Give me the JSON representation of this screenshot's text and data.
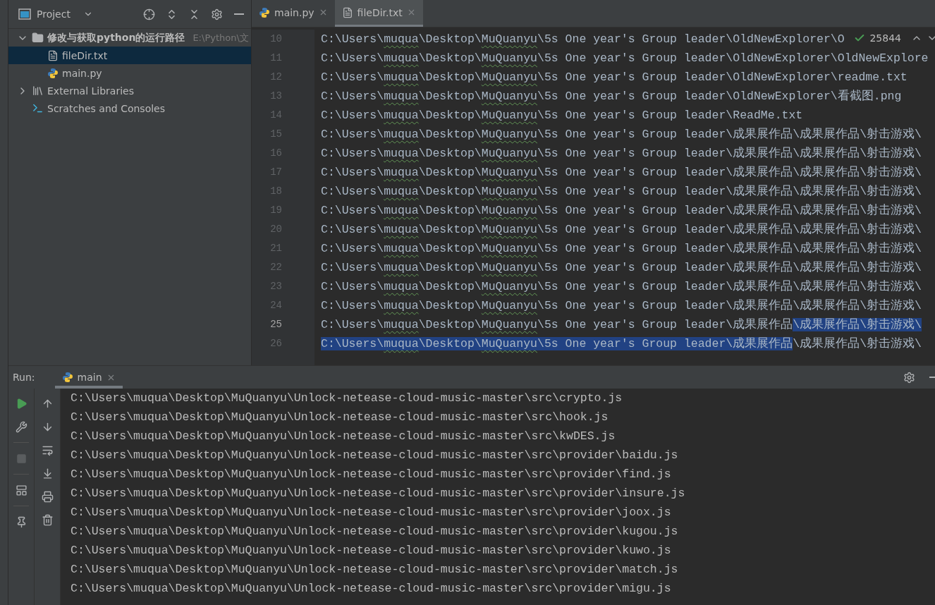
{
  "project_panel": {
    "title": "Project",
    "tree": [
      {
        "label": "修改与获取python的运行路径",
        "path": "E:\\Python\\文",
        "kind": "folder",
        "expanded": true,
        "selected": false,
        "children": [
          {
            "label": "fileDir.txt",
            "kind": "text-file",
            "selected": true
          },
          {
            "label": "main.py",
            "kind": "python-file",
            "selected": false
          }
        ]
      },
      {
        "label": "External Libraries",
        "kind": "library",
        "expanded": false,
        "selected": false
      },
      {
        "label": "Scratches and Consoles",
        "kind": "scratches",
        "selected": false
      }
    ]
  },
  "editor": {
    "tabs": [
      {
        "label": "main.py",
        "kind": "python-file",
        "selected": false
      },
      {
        "label": "fileDir.txt",
        "kind": "text-file",
        "selected": true
      }
    ],
    "inspection": {
      "count": "25844"
    },
    "lines": [
      {
        "number": "10",
        "current": false,
        "segments": [
          {
            "text": "C:\\Users\\",
            "typo": false,
            "selected": false
          },
          {
            "text": "muqua",
            "typo": true,
            "selected": false
          },
          {
            "text": "\\Desktop\\",
            "typo": false,
            "selected": false
          },
          {
            "text": "MuQuanyu",
            "typo": true,
            "selected": false
          },
          {
            "text": "\\5s One year's Group leader\\OldNewExplorer\\O",
            "typo": false,
            "selected": false
          }
        ]
      },
      {
        "number": "11",
        "current": false,
        "segments": [
          {
            "text": "C:\\Users\\",
            "typo": false,
            "selected": false
          },
          {
            "text": "muqua",
            "typo": true,
            "selected": false
          },
          {
            "text": "\\Desktop\\",
            "typo": false,
            "selected": false
          },
          {
            "text": "MuQuanyu",
            "typo": true,
            "selected": false
          },
          {
            "text": "\\5s One year's Group leader\\OldNewExplorer\\OldNewExplore",
            "typo": false,
            "selected": false
          }
        ]
      },
      {
        "number": "12",
        "current": false,
        "segments": [
          {
            "text": "C:\\Users\\",
            "typo": false,
            "selected": false
          },
          {
            "text": "muqua",
            "typo": true,
            "selected": false
          },
          {
            "text": "\\Desktop\\",
            "typo": false,
            "selected": false
          },
          {
            "text": "MuQuanyu",
            "typo": true,
            "selected": false
          },
          {
            "text": "\\5s One year's Group leader\\OldNewExplorer\\readme.txt",
            "typo": false,
            "selected": false
          }
        ]
      },
      {
        "number": "13",
        "current": false,
        "segments": [
          {
            "text": "C:\\Users\\",
            "typo": false,
            "selected": false
          },
          {
            "text": "muqua",
            "typo": true,
            "selected": false
          },
          {
            "text": "\\Desktop\\",
            "typo": false,
            "selected": false
          },
          {
            "text": "MuQuanyu",
            "typo": true,
            "selected": false
          },
          {
            "text": "\\5s One year's Group leader\\OldNewExplorer\\看截图.png",
            "typo": false,
            "selected": false
          }
        ]
      },
      {
        "number": "14",
        "current": false,
        "segments": [
          {
            "text": "C:\\Users\\",
            "typo": false,
            "selected": false
          },
          {
            "text": "muqua",
            "typo": true,
            "selected": false
          },
          {
            "text": "\\Desktop\\",
            "typo": false,
            "selected": false
          },
          {
            "text": "MuQuanyu",
            "typo": true,
            "selected": false
          },
          {
            "text": "\\5s One year's Group leader\\ReadMe.txt",
            "typo": false,
            "selected": false
          }
        ]
      },
      {
        "number": "15",
        "current": false,
        "segments": [
          {
            "text": "C:\\Users\\",
            "typo": false,
            "selected": false
          },
          {
            "text": "muqua",
            "typo": true,
            "selected": false
          },
          {
            "text": "\\Desktop\\",
            "typo": false,
            "selected": false
          },
          {
            "text": "MuQuanyu",
            "typo": true,
            "selected": false
          },
          {
            "text": "\\5s One year's Group leader\\成果展作品\\成果展作品\\射击游戏\\",
            "typo": false,
            "selected": false
          }
        ]
      },
      {
        "number": "16",
        "current": false,
        "segments": [
          {
            "text": "C:\\Users\\",
            "typo": false,
            "selected": false
          },
          {
            "text": "muqua",
            "typo": true,
            "selected": false
          },
          {
            "text": "\\Desktop\\",
            "typo": false,
            "selected": false
          },
          {
            "text": "MuQuanyu",
            "typo": true,
            "selected": false
          },
          {
            "text": "\\5s One year's Group leader\\成果展作品\\成果展作品\\射击游戏\\",
            "typo": false,
            "selected": false
          }
        ]
      },
      {
        "number": "17",
        "current": false,
        "segments": [
          {
            "text": "C:\\Users\\",
            "typo": false,
            "selected": false
          },
          {
            "text": "muqua",
            "typo": true,
            "selected": false
          },
          {
            "text": "\\Desktop\\",
            "typo": false,
            "selected": false
          },
          {
            "text": "MuQuanyu",
            "typo": true,
            "selected": false
          },
          {
            "text": "\\5s One year's Group leader\\成果展作品\\成果展作品\\射击游戏\\",
            "typo": false,
            "selected": false
          }
        ]
      },
      {
        "number": "18",
        "current": false,
        "segments": [
          {
            "text": "C:\\Users\\",
            "typo": false,
            "selected": false
          },
          {
            "text": "muqua",
            "typo": true,
            "selected": false
          },
          {
            "text": "\\Desktop\\",
            "typo": false,
            "selected": false
          },
          {
            "text": "MuQuanyu",
            "typo": true,
            "selected": false
          },
          {
            "text": "\\5s One year's Group leader\\成果展作品\\成果展作品\\射击游戏\\",
            "typo": false,
            "selected": false
          }
        ]
      },
      {
        "number": "19",
        "current": false,
        "segments": [
          {
            "text": "C:\\Users\\",
            "typo": false,
            "selected": false
          },
          {
            "text": "muqua",
            "typo": true,
            "selected": false
          },
          {
            "text": "\\Desktop\\",
            "typo": false,
            "selected": false
          },
          {
            "text": "MuQuanyu",
            "typo": true,
            "selected": false
          },
          {
            "text": "\\5s One year's Group leader\\成果展作品\\成果展作品\\射击游戏\\",
            "typo": false,
            "selected": false
          }
        ]
      },
      {
        "number": "20",
        "current": false,
        "segments": [
          {
            "text": "C:\\Users\\",
            "typo": false,
            "selected": false
          },
          {
            "text": "muqua",
            "typo": true,
            "selected": false
          },
          {
            "text": "\\Desktop\\",
            "typo": false,
            "selected": false
          },
          {
            "text": "MuQuanyu",
            "typo": true,
            "selected": false
          },
          {
            "text": "\\5s One year's Group leader\\成果展作品\\成果展作品\\射击游戏\\",
            "typo": false,
            "selected": false
          }
        ]
      },
      {
        "number": "21",
        "current": false,
        "segments": [
          {
            "text": "C:\\Users\\",
            "typo": false,
            "selected": false
          },
          {
            "text": "muqua",
            "typo": true,
            "selected": false
          },
          {
            "text": "\\Desktop\\",
            "typo": false,
            "selected": false
          },
          {
            "text": "MuQuanyu",
            "typo": true,
            "selected": false
          },
          {
            "text": "\\5s One year's Group leader\\成果展作品\\成果展作品\\射击游戏\\",
            "typo": false,
            "selected": false
          }
        ]
      },
      {
        "number": "22",
        "current": false,
        "segments": [
          {
            "text": "C:\\Users\\",
            "typo": false,
            "selected": false
          },
          {
            "text": "muqua",
            "typo": true,
            "selected": false
          },
          {
            "text": "\\Desktop\\",
            "typo": false,
            "selected": false
          },
          {
            "text": "MuQuanyu",
            "typo": true,
            "selected": false
          },
          {
            "text": "\\5s One year's Group leader\\成果展作品\\成果展作品\\射击游戏\\",
            "typo": false,
            "selected": false
          }
        ]
      },
      {
        "number": "23",
        "current": false,
        "segments": [
          {
            "text": "C:\\Users\\",
            "typo": false,
            "selected": false
          },
          {
            "text": "muqua",
            "typo": true,
            "selected": false
          },
          {
            "text": "\\Desktop\\",
            "typo": false,
            "selected": false
          },
          {
            "text": "MuQuanyu",
            "typo": true,
            "selected": false
          },
          {
            "text": "\\5s One year's Group leader\\成果展作品\\成果展作品\\射击游戏\\",
            "typo": false,
            "selected": false
          }
        ]
      },
      {
        "number": "24",
        "current": false,
        "segments": [
          {
            "text": "C:\\Users\\",
            "typo": false,
            "selected": false
          },
          {
            "text": "muqua",
            "typo": true,
            "selected": false
          },
          {
            "text": "\\Desktop\\",
            "typo": false,
            "selected": false
          },
          {
            "text": "MuQuanyu",
            "typo": true,
            "selected": false
          },
          {
            "text": "\\5s One year's Group leader\\成果展作品\\成果展作品\\射击游戏\\",
            "typo": false,
            "selected": false
          }
        ]
      },
      {
        "number": "25",
        "current": true,
        "segments": [
          {
            "text": "C:\\Users\\",
            "typo": false,
            "selected": false
          },
          {
            "text": "muqua",
            "typo": true,
            "selected": false
          },
          {
            "text": "\\Desktop\\",
            "typo": false,
            "selected": false
          },
          {
            "text": "MuQuanyu",
            "typo": true,
            "selected": false
          },
          {
            "text": "\\5s One year's Group leader\\成果展作品",
            "typo": false,
            "selected": false
          },
          {
            "text": "\\成果展作品\\射击游戏\\",
            "typo": false,
            "selected": true
          }
        ]
      },
      {
        "number": "26",
        "current": false,
        "segments": [
          {
            "text": "C:\\Users\\",
            "typo": false,
            "selected": true
          },
          {
            "text": "muqua",
            "typo": true,
            "selected": true
          },
          {
            "text": "\\Desktop\\",
            "typo": false,
            "selected": true
          },
          {
            "text": "MuQuanyu",
            "typo": true,
            "selected": true
          },
          {
            "text": "\\5s One year's Group leader\\成果展作品",
            "typo": false,
            "selected": true
          },
          {
            "text": "\\成果展作品\\射击游戏\\",
            "typo": false,
            "selected": false
          }
        ]
      }
    ]
  },
  "run_panel": {
    "label": "Run:",
    "tabs": [
      {
        "label": "main",
        "selected": true
      }
    ],
    "output": [
      "C:\\Users\\muqua\\Desktop\\MuQuanyu\\Unlock-netease-cloud-music-master\\src\\crypto.js",
      "C:\\Users\\muqua\\Desktop\\MuQuanyu\\Unlock-netease-cloud-music-master\\src\\hook.js",
      "C:\\Users\\muqua\\Desktop\\MuQuanyu\\Unlock-netease-cloud-music-master\\src\\kwDES.js",
      "C:\\Users\\muqua\\Desktop\\MuQuanyu\\Unlock-netease-cloud-music-master\\src\\provider\\baidu.js",
      "C:\\Users\\muqua\\Desktop\\MuQuanyu\\Unlock-netease-cloud-music-master\\src\\provider\\find.js",
      "C:\\Users\\muqua\\Desktop\\MuQuanyu\\Unlock-netease-cloud-music-master\\src\\provider\\insure.js",
      "C:\\Users\\muqua\\Desktop\\MuQuanyu\\Unlock-netease-cloud-music-master\\src\\provider\\joox.js",
      "C:\\Users\\muqua\\Desktop\\MuQuanyu\\Unlock-netease-cloud-music-master\\src\\provider\\kugou.js",
      "C:\\Users\\muqua\\Desktop\\MuQuanyu\\Unlock-netease-cloud-music-master\\src\\provider\\kuwo.js",
      "C:\\Users\\muqua\\Desktop\\MuQuanyu\\Unlock-netease-cloud-music-master\\src\\provider\\match.js",
      "C:\\Users\\muqua\\Desktop\\MuQuanyu\\Unlock-netease-cloud-music-master\\src\\provider\\migu.js"
    ]
  }
}
